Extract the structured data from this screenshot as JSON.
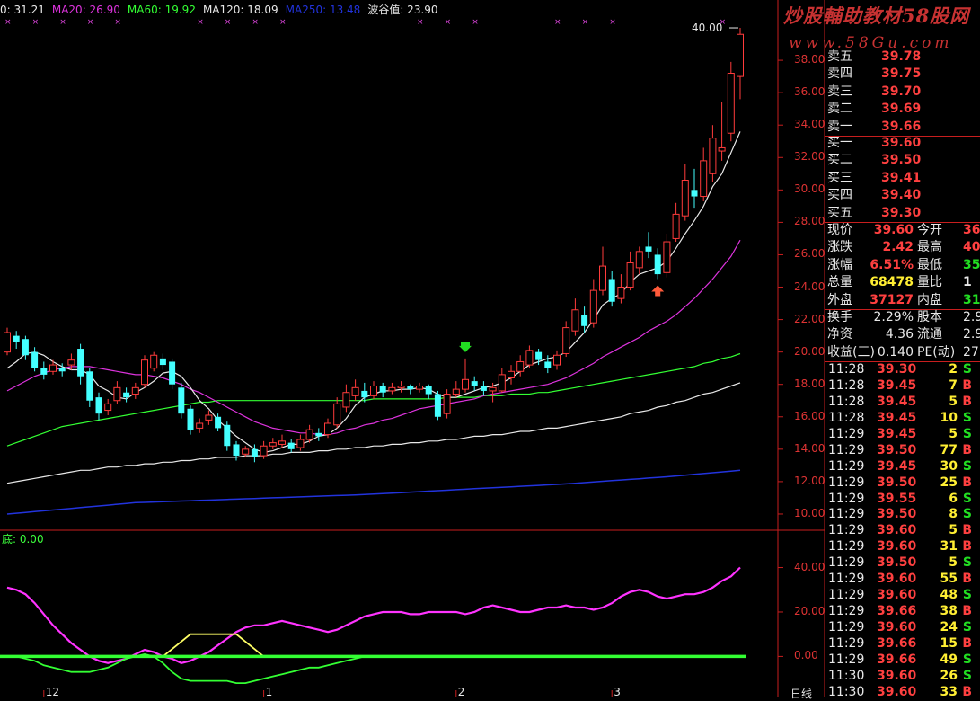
{
  "ma_bar": {
    "items": [
      {
        "text": "0: 31.21",
        "color": "#e8e8e8"
      },
      {
        "text": "MA20: 26.90",
        "color": "#dd33dd"
      },
      {
        "text": "MA60: 19.92",
        "color": "#33ff33"
      },
      {
        "text": "MA120: 18.09",
        "color": "#e8e8e8"
      },
      {
        "text": "MA250: 13.48",
        "color": "#2233dd"
      },
      {
        "text": "波谷值: 23.90",
        "color": "#e8e8e8"
      }
    ]
  },
  "indicator_label": "底: 0.00",
  "watermark": {
    "line1": "炒股輔助教材58股网",
    "line2": "www.58Gu.com"
  },
  "price_axis": [
    "38.00",
    "36.00",
    "34.00",
    "32.00",
    "30.00",
    "28.00",
    "26.00",
    "24.00",
    "22.00",
    "20.00",
    "18.00",
    "16.00",
    "14.00",
    "12.00",
    "10.00"
  ],
  "indicator_axis": [
    "40.00",
    "20.00",
    "0.00"
  ],
  "peak_label": "40.00",
  "asks": [
    {
      "label": "卖五",
      "price": "39.78"
    },
    {
      "label": "卖四",
      "price": "39.75"
    },
    {
      "label": "卖三",
      "price": "39.70"
    },
    {
      "label": "卖二",
      "price": "39.69"
    },
    {
      "label": "卖一",
      "price": "39.66"
    }
  ],
  "bids": [
    {
      "label": "买一",
      "price": "39.60"
    },
    {
      "label": "买二",
      "price": "39.50"
    },
    {
      "label": "买三",
      "price": "39.41"
    },
    {
      "label": "买四",
      "price": "39.40"
    },
    {
      "label": "买五",
      "price": "39.30"
    }
  ],
  "quote": [
    [
      {
        "l": "现价",
        "v": "39.60",
        "c": "red"
      },
      {
        "l": "今开",
        "v": "36",
        "c": "red"
      }
    ],
    [
      {
        "l": "涨跌",
        "v": "2.42",
        "c": "red"
      },
      {
        "l": "最高",
        "v": "40",
        "c": "red"
      }
    ],
    [
      {
        "l": "涨幅",
        "v": "6.51%",
        "c": "red"
      },
      {
        "l": "最低",
        "v": "35",
        "c": "green"
      }
    ],
    [
      {
        "l": "总量",
        "v": "68478",
        "c": "yellow"
      },
      {
        "l": "量比",
        "v": "1",
        "c": "white"
      }
    ],
    [
      {
        "l": "外盘",
        "v": "37127",
        "c": "red"
      },
      {
        "l": "内盘",
        "v": "31",
        "c": "green"
      }
    ]
  ],
  "fundamentals": [
    [
      {
        "l": "换手",
        "v": "2.29%"
      },
      {
        "l": "股本",
        "v": "2.9"
      }
    ],
    [
      {
        "l": "净资",
        "v": "4.36"
      },
      {
        "l": "流通",
        "v": "2.9"
      }
    ],
    [
      {
        "l": "收益(三)",
        "v": "0.140"
      },
      {
        "l": "PE(动)",
        "v": "27"
      }
    ]
  ],
  "ticks": [
    {
      "t": "11:28",
      "p": "39.30",
      "v": "2",
      "d": "S"
    },
    {
      "t": "11:28",
      "p": "39.45",
      "v": "7",
      "d": "B"
    },
    {
      "t": "11:28",
      "p": "39.45",
      "v": "5",
      "d": "B"
    },
    {
      "t": "11:28",
      "p": "39.45",
      "v": "10",
      "d": "S"
    },
    {
      "t": "11:29",
      "p": "39.45",
      "v": "5",
      "d": "S"
    },
    {
      "t": "11:29",
      "p": "39.50",
      "v": "77",
      "d": "B"
    },
    {
      "t": "11:29",
      "p": "39.45",
      "v": "30",
      "d": "S"
    },
    {
      "t": "11:29",
      "p": "39.50",
      "v": "25",
      "d": "B"
    },
    {
      "t": "11:29",
      "p": "39.55",
      "v": "6",
      "d": "S"
    },
    {
      "t": "11:29",
      "p": "39.50",
      "v": "8",
      "d": "S"
    },
    {
      "t": "11:29",
      "p": "39.60",
      "v": "5",
      "d": "B"
    },
    {
      "t": "11:29",
      "p": "39.60",
      "v": "31",
      "d": "B"
    },
    {
      "t": "11:29",
      "p": "39.50",
      "v": "5",
      "d": "S"
    },
    {
      "t": "11:29",
      "p": "39.60",
      "v": "55",
      "d": "B"
    },
    {
      "t": "11:29",
      "p": "39.60",
      "v": "48",
      "d": "S"
    },
    {
      "t": "11:29",
      "p": "39.66",
      "v": "38",
      "d": "B"
    },
    {
      "t": "11:29",
      "p": "39.60",
      "v": "24",
      "d": "S"
    },
    {
      "t": "11:29",
      "p": "39.66",
      "v": "15",
      "d": "B"
    },
    {
      "t": "11:29",
      "p": "39.66",
      "v": "49",
      "d": "S"
    },
    {
      "t": "11:30",
      "p": "39.60",
      "v": "26",
      "d": "S"
    },
    {
      "t": "11:30",
      "p": "39.60",
      "v": "33",
      "d": "B"
    }
  ],
  "bottom_label": "日线",
  "date_ticks": [
    "12",
    "1",
    "2",
    "3"
  ],
  "colors": {
    "up": "#ff3b3b",
    "down": "#44ffff",
    "ma5": "#e8e8e8",
    "ma20": "#dd33dd",
    "ma60": "#33ff33",
    "ma120": "#e8e8e8",
    "ma250": "#2233dd",
    "grid": "#c81e1e",
    "osc": "#ff33ff",
    "osc2": "#33ff33",
    "hump": "#ffff66",
    "zero": "#33ff33"
  },
  "chart_data": {
    "type": "candlestick",
    "ylim": [
      9,
      40.5
    ],
    "candles": [
      [
        20.0,
        21.2,
        21.5,
        19.8
      ],
      [
        21.0,
        20.6,
        21.3,
        20.2
      ],
      [
        20.8,
        19.8,
        21.0,
        19.5
      ],
      [
        20.0,
        19.0,
        20.3,
        18.8
      ],
      [
        19.0,
        18.6,
        19.4,
        18.3
      ],
      [
        18.8,
        19.2,
        19.5,
        18.6
      ],
      [
        19.0,
        18.8,
        19.3,
        18.5
      ],
      [
        19.2,
        19.5,
        19.9,
        18.9
      ],
      [
        20.2,
        18.5,
        20.5,
        18.0
      ],
      [
        18.8,
        17.0,
        19.0,
        16.6
      ],
      [
        17.2,
        16.2,
        17.5,
        15.8
      ],
      [
        16.4,
        16.8,
        17.1,
        16.1
      ],
      [
        17.0,
        17.8,
        18.2,
        16.8
      ],
      [
        17.5,
        17.2,
        17.8,
        16.9
      ],
      [
        17.4,
        17.8,
        18.1,
        17.1
      ],
      [
        18.0,
        19.5,
        19.8,
        17.8
      ],
      [
        19.0,
        19.8,
        20.0,
        18.8
      ],
      [
        19.6,
        19.2,
        19.9,
        18.9
      ],
      [
        19.4,
        18.0,
        19.6,
        17.7
      ],
      [
        17.8,
        16.2,
        18.1,
        15.9
      ],
      [
        16.5,
        15.2,
        16.7,
        14.9
      ],
      [
        15.3,
        15.6,
        15.9,
        15.0
      ],
      [
        15.8,
        16.1,
        16.4,
        15.5
      ],
      [
        16.0,
        15.3,
        16.2,
        15.1
      ],
      [
        15.5,
        14.2,
        15.7,
        13.9
      ],
      [
        14.3,
        13.6,
        14.5,
        13.3
      ],
      [
        13.7,
        14.0,
        14.2,
        13.5
      ],
      [
        14.0,
        13.5,
        14.3,
        13.2
      ],
      [
        13.6,
        14.2,
        14.5,
        13.4
      ],
      [
        14.2,
        14.4,
        14.7,
        14.0
      ],
      [
        14.3,
        14.5,
        14.9,
        14.1
      ],
      [
        14.4,
        14.0,
        14.6,
        13.8
      ],
      [
        14.1,
        14.6,
        14.9,
        13.9
      ],
      [
        14.6,
        15.2,
        15.5,
        14.4
      ],
      [
        15.0,
        14.8,
        15.3,
        14.5
      ],
      [
        14.9,
        15.6,
        15.9,
        14.7
      ],
      [
        15.5,
        16.8,
        17.2,
        15.3
      ],
      [
        16.6,
        17.5,
        18.0,
        16.3
      ],
      [
        17.3,
        17.8,
        18.3,
        17.0
      ],
      [
        17.6,
        17.2,
        18.1,
        16.9
      ],
      [
        17.3,
        17.9,
        18.2,
        17.1
      ],
      [
        17.9,
        17.5,
        18.1,
        17.2
      ],
      [
        17.6,
        17.8,
        18.1,
        17.4
      ],
      [
        17.8,
        17.9,
        18.2,
        17.5
      ],
      [
        17.9,
        17.7,
        18.0,
        17.4
      ],
      [
        17.7,
        17.9,
        18.1,
        17.5
      ],
      [
        17.9,
        17.4,
        18.0,
        17.1
      ],
      [
        17.4,
        16.0,
        17.6,
        15.8
      ],
      [
        16.2,
        17.4,
        17.7,
        15.9
      ],
      [
        17.4,
        17.7,
        18.2,
        17.2
      ],
      [
        17.7,
        18.3,
        19.6,
        17.5
      ],
      [
        18.2,
        17.9,
        18.5,
        17.6
      ],
      [
        17.9,
        17.6,
        18.2,
        17.3
      ],
      [
        17.6,
        17.8,
        18.1,
        16.9
      ],
      [
        17.6,
        18.6,
        19.0,
        17.5
      ],
      [
        18.4,
        18.8,
        19.2,
        18.0
      ],
      [
        18.8,
        19.4,
        19.8,
        18.5
      ],
      [
        19.2,
        20.1,
        20.4,
        19.0
      ],
      [
        20.0,
        19.5,
        20.2,
        19.2
      ],
      [
        19.4,
        19.0,
        19.8,
        18.7
      ],
      [
        19.2,
        19.8,
        20.1,
        18.9
      ],
      [
        19.9,
        21.5,
        21.9,
        19.7
      ],
      [
        21.3,
        22.6,
        23.3,
        21.0
      ],
      [
        22.3,
        21.6,
        22.8,
        21.2
      ],
      [
        21.8,
        23.8,
        24.5,
        21.5
      ],
      [
        23.8,
        25.3,
        26.5,
        23.5
      ],
      [
        24.5,
        23.1,
        25.0,
        22.8
      ],
      [
        23.3,
        24.0,
        24.8,
        23.0
      ],
      [
        24.0,
        25.5,
        26.2,
        23.8
      ],
      [
        25.2,
        26.2,
        26.5,
        24.8
      ],
      [
        26.5,
        26.2,
        27.4,
        25.8
      ],
      [
        26.0,
        24.8,
        26.4,
        24.5
      ],
      [
        24.9,
        26.8,
        27.3,
        24.6
      ],
      [
        27.0,
        28.5,
        29.2,
        26.8
      ],
      [
        28.4,
        30.6,
        31.6,
        28.1
      ],
      [
        30.0,
        29.6,
        31.3,
        28.9
      ],
      [
        29.6,
        31.8,
        32.6,
        29.3
      ],
      [
        31.0,
        33.2,
        34.0,
        30.5
      ],
      [
        32.4,
        32.6,
        35.4,
        31.8
      ],
      [
        33.5,
        37.2,
        37.9,
        33.0
      ],
      [
        37.0,
        39.6,
        40.0,
        35.6
      ]
    ],
    "ma5": [
      19.0,
      19.4,
      19.9,
      20.0,
      19.8,
      19.4,
      19.1,
      18.9,
      18.9,
      18.6,
      17.9,
      17.6,
      17.2,
      17.1,
      17.5,
      17.8,
      18.2,
      18.7,
      18.8,
      18.5,
      17.8,
      17.0,
      16.5,
      15.8,
      15.3,
      14.8,
      14.4,
      14.0,
      13.8,
      13.9,
      14.1,
      14.3,
      14.3,
      14.5,
      14.8,
      14.9,
      15.3,
      15.9,
      16.7,
      17.2,
      17.4,
      17.6,
      17.6,
      17.7,
      17.7,
      17.8,
      17.7,
      17.4,
      17.2,
      17.2,
      17.4,
      17.6,
      17.8,
      17.9,
      18.1,
      18.4,
      18.8,
      19.2,
      19.4,
      19.6,
      19.7,
      20.0,
      20.6,
      21.2,
      22.0,
      22.9,
      23.3,
      23.6,
      24.3,
      24.8,
      25.0,
      25.2,
      25.6,
      26.4,
      27.3,
      28.1,
      29.0,
      30.2,
      31.0,
      32.3,
      33.6
    ],
    "ma20": [
      17.6,
      17.9,
      18.2,
      18.5,
      18.7,
      18.9,
      19.0,
      19.1,
      19.1,
      19.1,
      19.0,
      18.9,
      18.8,
      18.7,
      18.6,
      18.6,
      18.5,
      18.4,
      18.2,
      18.0,
      17.7,
      17.5,
      17.2,
      16.9,
      16.6,
      16.3,
      16.0,
      15.7,
      15.5,
      15.3,
      15.2,
      15.1,
      15.0,
      15.0,
      14.9,
      14.9,
      15.0,
      15.2,
      15.3,
      15.5,
      15.6,
      15.8,
      15.9,
      16.1,
      16.3,
      16.5,
      16.6,
      16.7,
      16.8,
      16.9,
      17.0,
      17.1,
      17.3,
      17.4,
      17.5,
      17.6,
      17.7,
      17.8,
      17.9,
      18.0,
      18.2,
      18.4,
      18.7,
      19.0,
      19.3,
      19.7,
      20.0,
      20.3,
      20.6,
      20.9,
      21.3,
      21.6,
      21.9,
      22.3,
      22.8,
      23.3,
      23.9,
      24.5,
      25.2,
      25.9,
      26.9
    ],
    "ma60": [
      14.2,
      14.4,
      14.6,
      14.8,
      15.0,
      15.2,
      15.4,
      15.5,
      15.6,
      15.7,
      15.8,
      15.9,
      16.0,
      16.1,
      16.2,
      16.3,
      16.4,
      16.5,
      16.6,
      16.7,
      16.8,
      16.9,
      16.9,
      17.0,
      17.0,
      17.0,
      17.0,
      17.0,
      17.0,
      17.0,
      17.0,
      17.0,
      17.0,
      17.0,
      17.0,
      17.0,
      17.0,
      17.0,
      17.0,
      17.0,
      17.1,
      17.1,
      17.1,
      17.1,
      17.1,
      17.1,
      17.1,
      17.1,
      17.2,
      17.2,
      17.2,
      17.2,
      17.3,
      17.3,
      17.3,
      17.4,
      17.4,
      17.4,
      17.5,
      17.5,
      17.6,
      17.7,
      17.8,
      17.9,
      18.0,
      18.1,
      18.2,
      18.3,
      18.4,
      18.5,
      18.6,
      18.7,
      18.8,
      18.9,
      19.0,
      19.1,
      19.3,
      19.4,
      19.6,
      19.7,
      19.9
    ],
    "ma120": [
      11.9,
      12.0,
      12.1,
      12.2,
      12.3,
      12.4,
      12.5,
      12.6,
      12.7,
      12.7,
      12.8,
      12.9,
      12.9,
      13.0,
      13.0,
      13.1,
      13.1,
      13.2,
      13.2,
      13.3,
      13.3,
      13.4,
      13.4,
      13.5,
      13.5,
      13.5,
      13.6,
      13.6,
      13.6,
      13.7,
      13.7,
      13.8,
      13.8,
      13.8,
      13.9,
      13.9,
      14.0,
      14.0,
      14.1,
      14.1,
      14.2,
      14.2,
      14.3,
      14.3,
      14.4,
      14.4,
      14.5,
      14.5,
      14.6,
      14.6,
      14.7,
      14.8,
      14.8,
      14.9,
      14.9,
      15.0,
      15.1,
      15.1,
      15.2,
      15.3,
      15.3,
      15.4,
      15.5,
      15.6,
      15.7,
      15.8,
      15.9,
      16.0,
      16.2,
      16.3,
      16.4,
      16.6,
      16.7,
      16.9,
      17.0,
      17.2,
      17.4,
      17.5,
      17.7,
      17.9,
      18.1
    ],
    "ma250": [
      10.0,
      10.05,
      10.1,
      10.15,
      10.2,
      10.25,
      10.3,
      10.35,
      10.4,
      10.45,
      10.5,
      10.55,
      10.6,
      10.65,
      10.7,
      10.72,
      10.74,
      10.76,
      10.78,
      10.8,
      10.82,
      10.84,
      10.86,
      10.88,
      10.9,
      10.92,
      10.94,
      10.96,
      10.98,
      11.0,
      11.02,
      11.04,
      11.06,
      11.08,
      11.1,
      11.12,
      11.14,
      11.16,
      11.18,
      11.2,
      11.23,
      11.26,
      11.29,
      11.32,
      11.35,
      11.38,
      11.41,
      11.44,
      11.47,
      11.5,
      11.53,
      11.56,
      11.59,
      11.62,
      11.65,
      11.68,
      11.71,
      11.74,
      11.77,
      11.8,
      11.83,
      11.86,
      11.9,
      11.94,
      11.98,
      12.02,
      12.06,
      12.1,
      12.14,
      12.18,
      12.22,
      12.26,
      12.3,
      12.35,
      12.4,
      12.45,
      12.5,
      12.55,
      12.6,
      12.65,
      12.7
    ],
    "oscillator": {
      "ylim": [
        -14,
        56
      ],
      "pink": [
        31,
        30,
        28,
        24,
        19,
        14,
        10,
        6,
        3,
        0,
        -2,
        -3,
        -2,
        -1,
        1,
        3,
        2,
        0,
        -1,
        -3,
        -2,
        0,
        2,
        5,
        8,
        11,
        13,
        14,
        14,
        15,
        16,
        15,
        14,
        13,
        12,
        11,
        12,
        14,
        16,
        18,
        19,
        20,
        20,
        20,
        19,
        19,
        20,
        20,
        20,
        20,
        19,
        20,
        22,
        23,
        22,
        21,
        20,
        20,
        21,
        22,
        22,
        23,
        22,
        22,
        21,
        22,
        24,
        27,
        29,
        30,
        29,
        27,
        26,
        27,
        28,
        28,
        29,
        31,
        34,
        36,
        40
      ],
      "green": [
        0,
        0,
        -1,
        -2,
        -4,
        -5,
        -6,
        -7,
        -7,
        -7,
        -6,
        -5,
        -3,
        -1,
        0,
        1,
        0,
        -3,
        -7,
        -10,
        -11,
        -11,
        -11,
        -11,
        -11,
        -12,
        -12,
        -11,
        -10,
        -9,
        -8,
        -7,
        -6,
        -5,
        -5,
        -4,
        -3,
        -2,
        -1,
        0,
        0,
        0
      ],
      "hump_x": [
        17,
        20,
        25,
        28
      ],
      "hump_y": [
        0,
        10,
        10,
        0
      ],
      "zero": 0
    },
    "markers": {
      "down_arrow_index": 50,
      "up_arrow_index": 71
    }
  }
}
